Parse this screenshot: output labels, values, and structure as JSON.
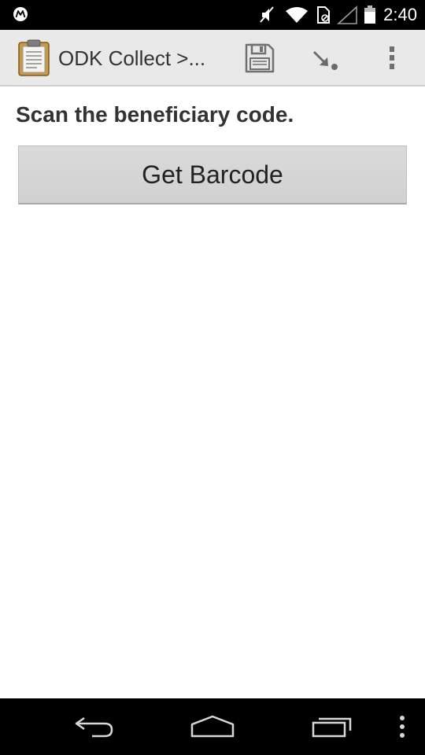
{
  "status_bar": {
    "time": "2:40",
    "icons": [
      "motorola-logo-icon",
      "mute-icon",
      "wifi-icon",
      "sim-icon",
      "signal-icon",
      "battery-icon"
    ]
  },
  "action_bar": {
    "title": "ODK Collect >...",
    "icons": [
      "clipboard-app-icon",
      "save-icon",
      "goto-arrow-icon",
      "overflow-menu-icon"
    ]
  },
  "form": {
    "question": "Scan the beneficiary code.",
    "button_label": "Get Barcode"
  },
  "nav_bar": {
    "icons": [
      "back-icon",
      "home-icon",
      "recents-icon",
      "menu-icon"
    ]
  },
  "colors": {
    "status_bar_bg": "#000000",
    "action_bar_bg": "#e9e9e9",
    "button_bg": "#d5d5d5",
    "text": "#333333"
  }
}
